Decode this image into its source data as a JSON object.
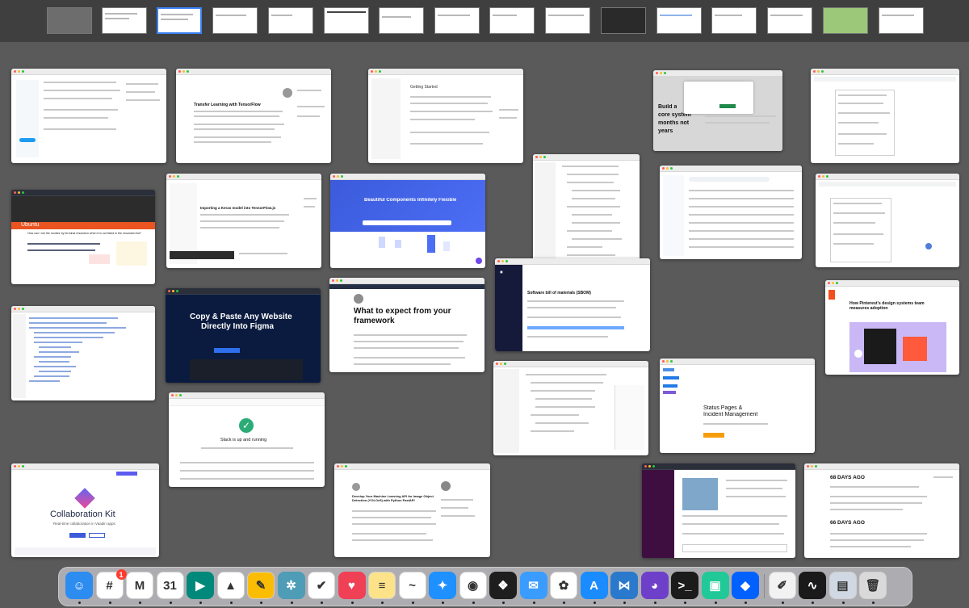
{
  "mission_control": {
    "spaces_count": 17,
    "selected_space": 3
  },
  "windows": {
    "tensorflow": {
      "title": "Transfer Learning with TensorFlow"
    },
    "tf_docs": {
      "title": "Getting Started"
    },
    "ad_block": {
      "headline_a": "Build a",
      "headline_b": "core system",
      "headline_c": "months not",
      "headline_d": "years"
    },
    "ubuntu": {
      "brand": "Ubuntu",
      "question": "How can I set the monitor by terminal resolution when it is not listed in the resolution list?"
    },
    "keras": {
      "title": "Importing a Keras model into TensorFlow.js"
    },
    "components": {
      "title": "Beautiful Components Infinitely Flexible"
    },
    "figma_copy": {
      "title_a": "Copy & Paste Any Website",
      "title_b": "Directly Into Figma"
    },
    "framework_article": {
      "title_a": "What to expect from your",
      "title_b": "framework"
    },
    "sbom": {
      "title": "Software bill of materials (SBOM)"
    },
    "pinterest": {
      "title": "How Pinterest's design systems team measures adoption"
    },
    "slack_status": {
      "message": "Slack is up and running"
    },
    "statuspage": {
      "title_a": "Status Pages &",
      "title_b": "Incident Management"
    },
    "collab_kit": {
      "title": "Collaboration Kit",
      "subtitle": "Real-time collaboration in Vaadin apps"
    },
    "ml_api": {
      "title": "Develop Your Machine Learning API for Image Object Detection (YOLOv5) with Python FastAPI"
    },
    "days_ago": {
      "first": "68 DAYS AGO",
      "second": "66 DAYS AGO"
    }
  },
  "dock": {
    "apps": [
      {
        "name": "finder-icon",
        "glyph": "☺",
        "color": "#2d8cf0"
      },
      {
        "name": "slack-icon",
        "glyph": "#",
        "color": "#ffffff",
        "badge": "1"
      },
      {
        "name": "gmail-icon",
        "glyph": "M",
        "color": "#ffffff"
      },
      {
        "name": "google-calendar-icon",
        "glyph": "31",
        "color": "#ffffff"
      },
      {
        "name": "google-meet-icon",
        "glyph": "▶",
        "color": "#00897b"
      },
      {
        "name": "google-drive-icon",
        "glyph": "▲",
        "color": "#ffffff"
      },
      {
        "name": "google-keep-icon",
        "glyph": "✎",
        "color": "#fbbc04"
      },
      {
        "name": "loom-icon",
        "glyph": "✲",
        "color": "#4e9cb6"
      },
      {
        "name": "things-icon",
        "glyph": "✔",
        "color": "#ffffff"
      },
      {
        "name": "pocket-icon",
        "glyph": "♥",
        "color": "#ef4056"
      },
      {
        "name": "notes-icon",
        "glyph": "≡",
        "color": "#fce38a"
      },
      {
        "name": "freeform-icon",
        "glyph": "~",
        "color": "#ffffff"
      },
      {
        "name": "safari-icon",
        "glyph": "✦",
        "color": "#1e90ff"
      },
      {
        "name": "chrome-icon",
        "glyph": "◉",
        "color": "#ffffff"
      },
      {
        "name": "figma-icon",
        "glyph": "❖",
        "color": "#1e1e1e"
      },
      {
        "name": "mail-icon",
        "glyph": "✉",
        "color": "#3b9cff"
      },
      {
        "name": "photos-icon",
        "glyph": "✿",
        "color": "#ffffff"
      },
      {
        "name": "app-store-icon",
        "glyph": "A",
        "color": "#1a8cff"
      },
      {
        "name": "vscode-icon",
        "glyph": "⋈",
        "color": "#2b79cc"
      },
      {
        "name": "github-desktop-icon",
        "glyph": "◕",
        "color": "#6e40c9"
      },
      {
        "name": "terminal-icon",
        "glyph": ">_",
        "color": "#1b1b1b"
      },
      {
        "name": "devtoys-icon",
        "glyph": "▣",
        "color": "#20c997"
      },
      {
        "name": "dropbox-icon",
        "glyph": "◆",
        "color": "#0061ff"
      },
      {
        "name": "textedit-icon",
        "glyph": "✐",
        "color": "#f2f2f2"
      },
      {
        "name": "activity-monitor-icon",
        "glyph": "∿",
        "color": "#1a1a1a"
      },
      {
        "name": "preview-icon",
        "glyph": "▤",
        "color": "#cfd8e3"
      },
      {
        "name": "trash-icon",
        "glyph": "🗑",
        "color": "#d9d9d9"
      }
    ]
  }
}
